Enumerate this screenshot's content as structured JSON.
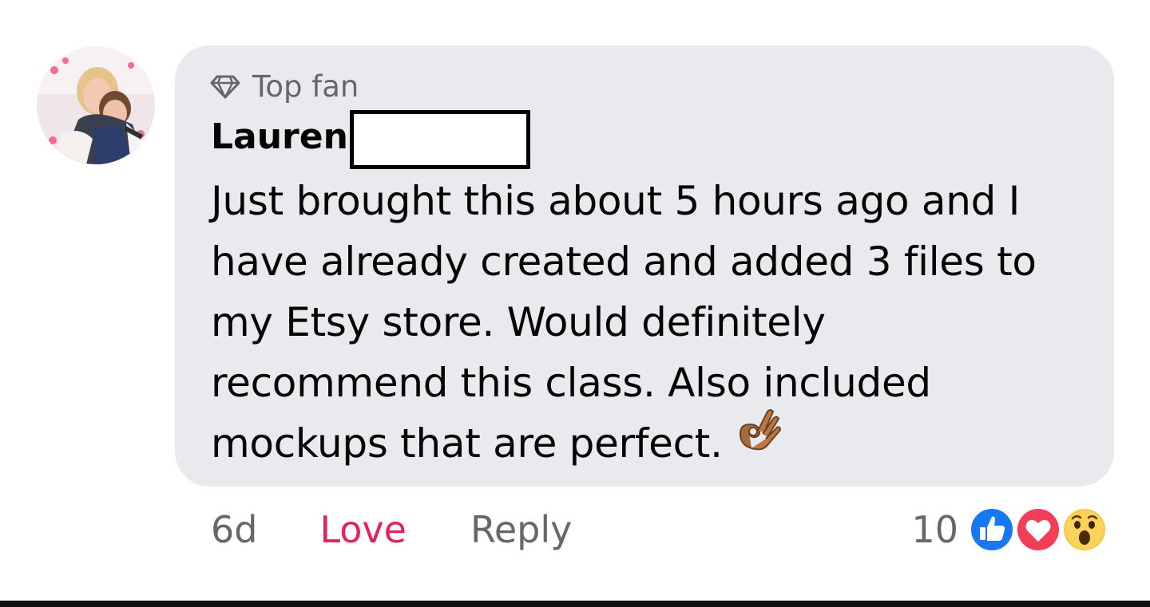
{
  "comment": {
    "badge": {
      "icon": "diamond-icon",
      "label": "Top fan"
    },
    "author": {
      "name": "Lauren"
    },
    "text_lines": [
      "Just brought this about 5 hours ago and I",
      "have already created and added 3 files to",
      "my Etsy store. Would definitely",
      "recommend this class. Also included",
      "mockups that are perfect."
    ],
    "emoji": "ok-hand-icon"
  },
  "actions": {
    "time": "6d",
    "love_label": "Love",
    "reply_label": "Reply"
  },
  "reactions": {
    "count": "10",
    "icons": [
      "like-reaction-icon",
      "love-reaction-icon",
      "wow-reaction-icon"
    ]
  },
  "colors": {
    "bubble": "#e9eaed",
    "love": "#e0245e",
    "muted": "#65676b",
    "like_blue": "#1877f2",
    "love_red": "#f33e58"
  }
}
